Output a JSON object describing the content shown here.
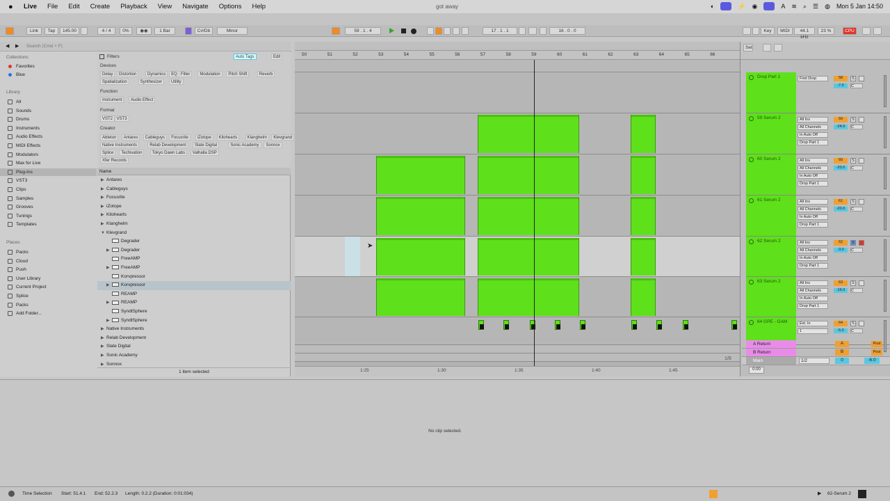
{
  "menubar": {
    "app": "Live",
    "items": [
      "File",
      "Edit",
      "Create",
      "Playback",
      "View",
      "Navigate",
      "Options",
      "Help"
    ],
    "window_title": "got away",
    "clock": "Mon 5 Jan  14:50"
  },
  "transport": {
    "link": "Link",
    "tap": "Tap",
    "tempo": "145.00",
    "signature": "4 / 4",
    "groove": "0%",
    "quantize": "1 Bar",
    "key": "C#/Db",
    "scale": "Minor",
    "position": "59 .  1 .  4",
    "loop_start": "17 .  1 .  1",
    "loop_length": "16 .  0 .  0",
    "key_btn": "Key",
    "midi_btn": "MIDI",
    "sample_rate": "44.1 kHz",
    "cpu_pct": "23 %",
    "cpu_label": "CPU"
  },
  "browser": {
    "search_placeholder": "Search (Cmd + F)",
    "sections": {
      "collections": "Collections",
      "library": "Library",
      "places": "Places"
    },
    "collections": [
      {
        "label": "Favorites",
        "color": "#e0342b"
      },
      {
        "label": "Blue",
        "color": "#2f6fe0"
      }
    ],
    "library": [
      "All",
      "Sounds",
      "Drums",
      "Instruments",
      "Audio Effects",
      "MIDI Effects",
      "Modulators",
      "Max for Live",
      "Plug-Ins",
      "VST3",
      "Clips",
      "Samples",
      "Grooves",
      "Tunings",
      "Templates"
    ],
    "places": [
      "Packs",
      "Cloud",
      "Push",
      "User Library",
      "Current Project",
      "Splice",
      "Packs",
      "Add Folder..."
    ],
    "filters": {
      "title": "Filters",
      "auto_tags": "Auto Tags",
      "edit": "Edit",
      "devices_label": "Devices",
      "devices": [
        "Delay",
        "Distortion",
        "Dynamics",
        "EQ",
        "Filter",
        "Modulation",
        "Pitch Shift",
        "Reverb",
        "Spatialization",
        "Synthesizer",
        "Utility"
      ],
      "function_label": "Function",
      "functions": [
        "Instrument",
        "Audio Effect"
      ],
      "format_label": "Format",
      "formats": [
        "VST2",
        "VST3"
      ],
      "creator_label": "Creator",
      "creators": [
        "Ableton",
        "Antares",
        "Cableguys",
        "Focusrite",
        "iZotope",
        "Kilohearts",
        "Klanghelm",
        "Klevgrand",
        "Native Instruments",
        "Relab Development",
        "Slate Digital",
        "Sonic Academy",
        "Sonnox",
        "Splice",
        "Techivation",
        "Tokyo Dawn Labs",
        "Valhalla DSP",
        "Xfer Records"
      ]
    },
    "list_header": "Name",
    "files": [
      {
        "label": "Antares",
        "arrow": "▶",
        "type": "folder"
      },
      {
        "label": "Cableguys",
        "arrow": "▶",
        "type": "folder"
      },
      {
        "label": "Focusrite",
        "arrow": "▶",
        "type": "folder"
      },
      {
        "label": "iZotope",
        "arrow": "▶",
        "type": "folder"
      },
      {
        "label": "Kilohearts",
        "arrow": "▶",
        "type": "folder"
      },
      {
        "label": "Klanghelm",
        "arrow": "▶",
        "type": "folder"
      },
      {
        "label": "Klevgrand",
        "arrow": "▼",
        "type": "folder"
      },
      {
        "label": "Degrader",
        "arrow": "",
        "type": "plugin"
      },
      {
        "label": "Degrader",
        "arrow": "▶",
        "type": "plugin"
      },
      {
        "label": "FreeAMP",
        "arrow": "",
        "type": "plugin"
      },
      {
        "label": "FreeAMP",
        "arrow": "▶",
        "type": "plugin"
      },
      {
        "label": "Korvpressor",
        "arrow": "",
        "type": "plugin"
      },
      {
        "label": "Korvpressor",
        "arrow": "▶",
        "type": "plugin",
        "selected": true
      },
      {
        "label": "REAMP",
        "arrow": "",
        "type": "plugin"
      },
      {
        "label": "REAMP",
        "arrow": "▶",
        "type": "plugin"
      },
      {
        "label": "SyndtSphere",
        "arrow": "",
        "type": "plugin"
      },
      {
        "label": "SyndtSphere",
        "arrow": "▶",
        "type": "plugin"
      },
      {
        "label": "Native Instruments",
        "arrow": "▶",
        "type": "folder"
      },
      {
        "label": "Relab Development",
        "arrow": "▶",
        "type": "folder"
      },
      {
        "label": "Slate Digital",
        "arrow": "▶",
        "type": "folder"
      },
      {
        "label": "Sonic Academy",
        "arrow": "▶",
        "type": "folder"
      },
      {
        "label": "Sonnox",
        "arrow": "▶",
        "type": "folder"
      }
    ],
    "footer": "1 item selected"
  },
  "arrangement": {
    "bars": [
      "50",
      "51",
      "52",
      "53",
      "54",
      "55",
      "56",
      "57",
      "58",
      "59",
      "60",
      "61",
      "62",
      "63",
      "64",
      "65",
      "66"
    ],
    "times": [
      "1:25",
      "1:30",
      "1:35",
      "1:40",
      "1:45"
    ],
    "zoom_label": "1/8",
    "clip_color": "#5ee01a"
  },
  "tracks": [
    {
      "name": "Drop Part 1",
      "input": "First Drop",
      "num": "58",
      "vol": "-7.0",
      "pan": "C",
      "sub": []
    },
    {
      "name": "59 Serum 2",
      "input": "All Ins",
      "num": "59",
      "vol": "-24.0",
      "pan": "C",
      "sub": [
        "All Channels",
        "In  Auto  Off",
        "Drop Part 1"
      ]
    },
    {
      "name": "60 Serum 2",
      "input": "All Ins",
      "num": "60",
      "vol": "-20.0",
      "pan": "C",
      "sub": [
        "All Channels",
        "In  Auto  Off",
        "Drop Part 1"
      ]
    },
    {
      "name": "61 Serum 2",
      "input": "All Ins",
      "num": "61",
      "vol": "-20.0",
      "pan": "C",
      "sub": [
        "All Channels",
        "In  Auto  Off",
        "Drop Part 1"
      ]
    },
    {
      "name": "62 Serum 2",
      "input": "All Ins",
      "num": "62",
      "vol": "-3.0",
      "pan": "C",
      "sub": [
        "All Channels",
        "In  Auto  Off",
        "Drop Part 1"
      ]
    },
    {
      "name": "63 Serum 2",
      "input": "All Ins",
      "num": "63",
      "vol": "-16.0",
      "pan": "C",
      "sub": [
        "All Channels",
        "In  Auto  Off",
        "Drop Part 1"
      ]
    },
    {
      "name": "64 GPE - GAM",
      "input": "Ext. In",
      "num": "64",
      "vol": "-5.0",
      "pan": "C",
      "sub": [
        "1"
      ]
    }
  ],
  "returns": [
    {
      "name": "A Return",
      "letter": "A",
      "post": "Post"
    },
    {
      "name": "B Return",
      "letter": "B",
      "post": "Post"
    }
  ],
  "main": {
    "name": "Main",
    "input": "1/2",
    "vol": "0",
    "pan": "-6.0"
  },
  "meter_clip": "0.00",
  "detail": {
    "message": "No clip selected."
  },
  "status": {
    "selection": "Time Selection",
    "start": "Start: 51.4.1",
    "end": "End: 52.2.3",
    "length": "Length: 0.2.2  (Duration: 0:01:034)",
    "track": "62-Serum 2"
  }
}
